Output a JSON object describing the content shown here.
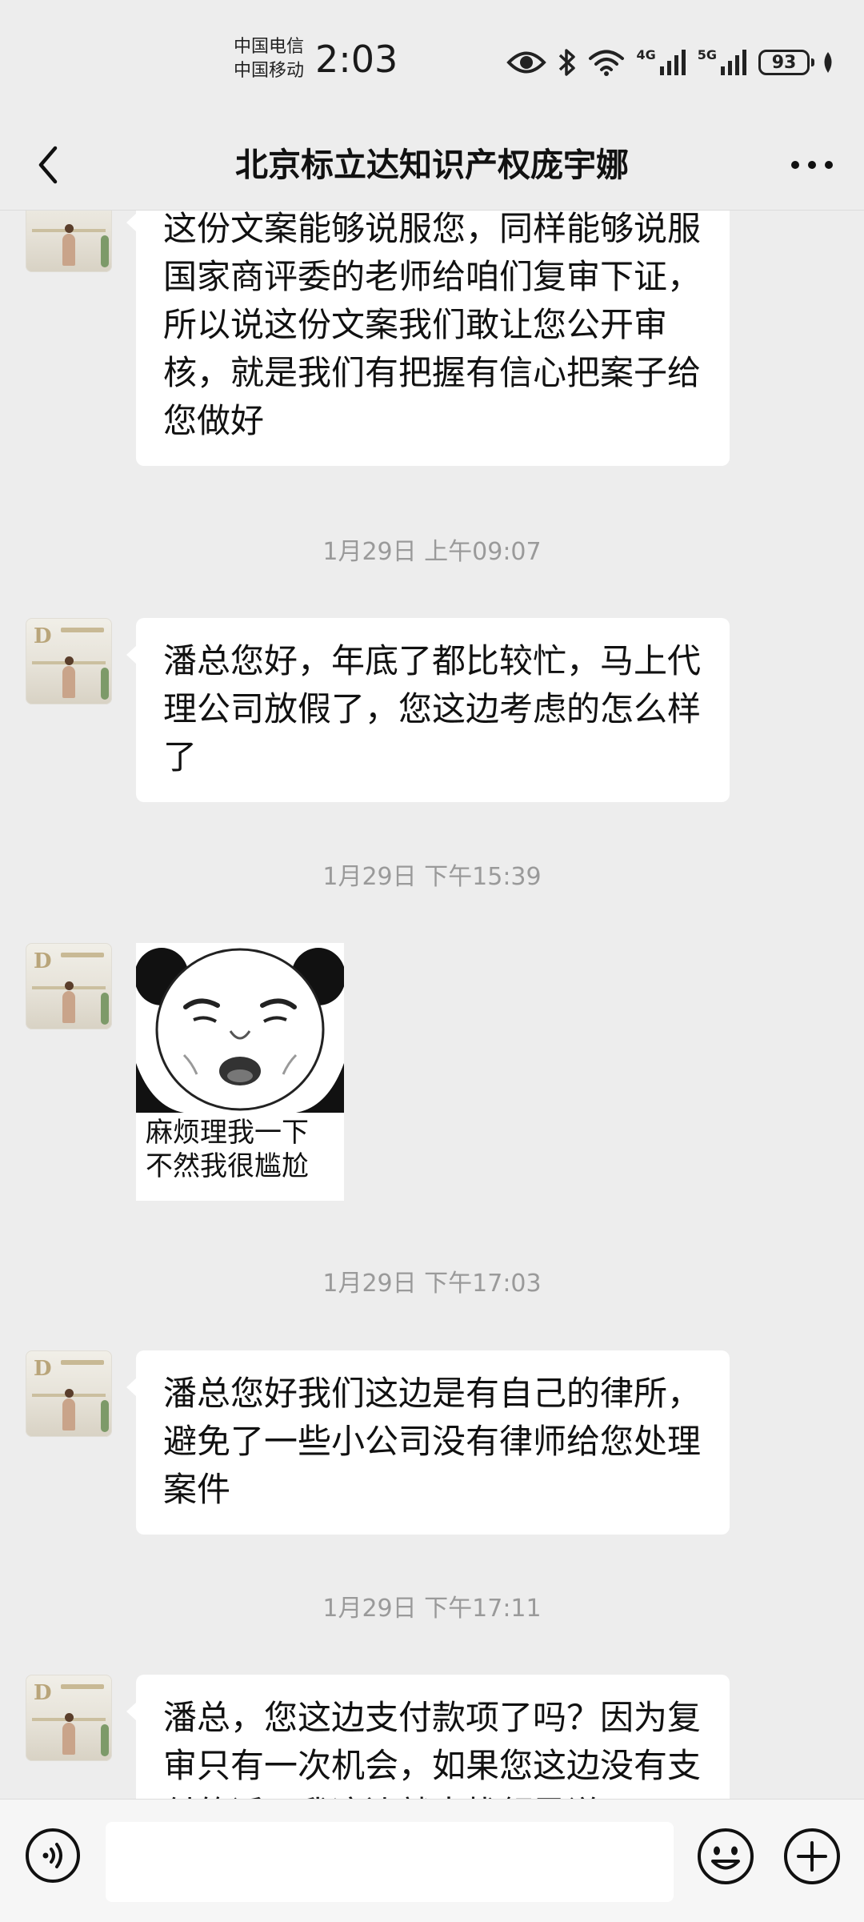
{
  "status_bar": {
    "carrier_1": "中国电信",
    "carrier_2": "中国移动",
    "time": "2:03",
    "net_1": "4G",
    "net_2": "5G",
    "battery": "93"
  },
  "header": {
    "title": "北京标立达知识产权庞宇娜"
  },
  "messages": [
    {
      "type": "text",
      "text": "这份文案能够说服您，同样能够说服国家商评委的老师给咱们复审下证，所以说这份文案我们敢让您公开审核，就是我们有把握有信心把案子给您做好"
    },
    {
      "type": "time",
      "text": "1月29日 上午09:07"
    },
    {
      "type": "text",
      "text": "潘总您好，年底了都比较忙，马上代理公司放假了，您这边考虑的怎么样了"
    },
    {
      "type": "time",
      "text": "1月29日 下午15:39"
    },
    {
      "type": "sticker",
      "caption_1": "麻烦理我一下",
      "caption_2": "不然我很尴尬"
    },
    {
      "type": "time",
      "text": "1月29日 下午17:03"
    },
    {
      "type": "text",
      "text": "潘总您好我们这边是有自己的律所，避免了一些小公司没有律师给您处理案件"
    },
    {
      "type": "time",
      "text": "1月29日 下午17:11"
    },
    {
      "type": "text",
      "text": "潘总，您这边支付款项了吗？因为复审只有一次机会，如果您这边没有支付的话，我这边就去找领导说"
    }
  ],
  "avatar": {
    "logo": "D"
  },
  "input_bar": {
    "value": ""
  },
  "icons": [
    "back-arrow-icon",
    "more-icon",
    "eye-icon",
    "bluetooth-icon",
    "wifi-icon",
    "signal-icon",
    "voice-icon",
    "emoji-icon",
    "plus-icon"
  ]
}
